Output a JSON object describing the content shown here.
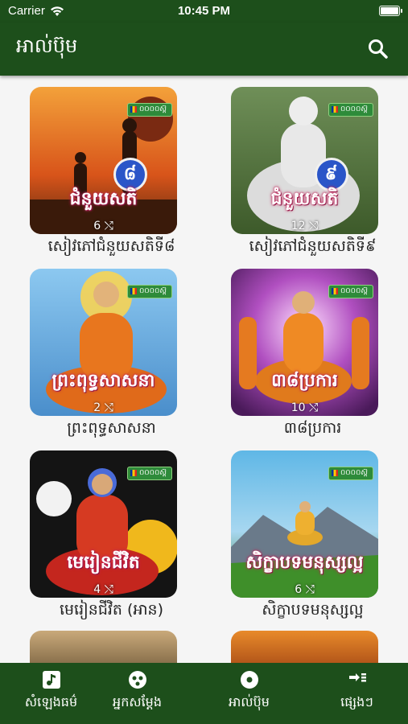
{
  "status": {
    "carrier": "Carrier",
    "time": "10:45 PM"
  },
  "header": {
    "title": "អាល់ប៊ុម",
    "search_icon": "search-icon"
  },
  "badge_text": "០០០០ស្ដ៊",
  "albums": [
    {
      "label": "សៀវភៅជំនួយសតិទី៨",
      "cover_text": "ជំនួយសតិ",
      "number": "៨",
      "plays": "6",
      "theme": "sunset"
    },
    {
      "label": "សៀវភៅជំនួយសតិទី៩",
      "cover_text": "ជំនួយសតិ",
      "number": "៩",
      "plays": "12",
      "theme": "statue"
    },
    {
      "label": "ព្រះពុទ្ធសាសនា",
      "cover_text": "ព្រះពុទ្ធសាសនា",
      "number": "",
      "plays": "2",
      "theme": "buddha-orange"
    },
    {
      "label": "៣៨ប្រការ",
      "cover_text": "៣៨ប្រការ",
      "number": "",
      "plays": "10",
      "theme": "buddha-purple"
    },
    {
      "label": "មេរៀនជីវិត (អាន)",
      "cover_text": "មេរៀនជីវិត",
      "number": "",
      "plays": "4",
      "theme": "buddha-flowers"
    },
    {
      "label": "សិក្ខាបទមនុស្សល្អ",
      "cover_text": "សិក្ខាបទមនុស្សល្អ",
      "number": "",
      "plays": "6",
      "theme": "landscape"
    }
  ],
  "tabs": [
    {
      "label": "សំឡេងធម៌",
      "icon": "music-note-icon"
    },
    {
      "label": "អ្នកសម្ដែង",
      "icon": "artist-icon"
    },
    {
      "label": "អាល់ប៊ុម",
      "icon": "album-icon"
    },
    {
      "label": "ផ្សេងៗ",
      "icon": "more-icon"
    }
  ],
  "colors": {
    "primary": "#1d4f1b",
    "text": "#222222",
    "background": "#f5f5f5"
  }
}
